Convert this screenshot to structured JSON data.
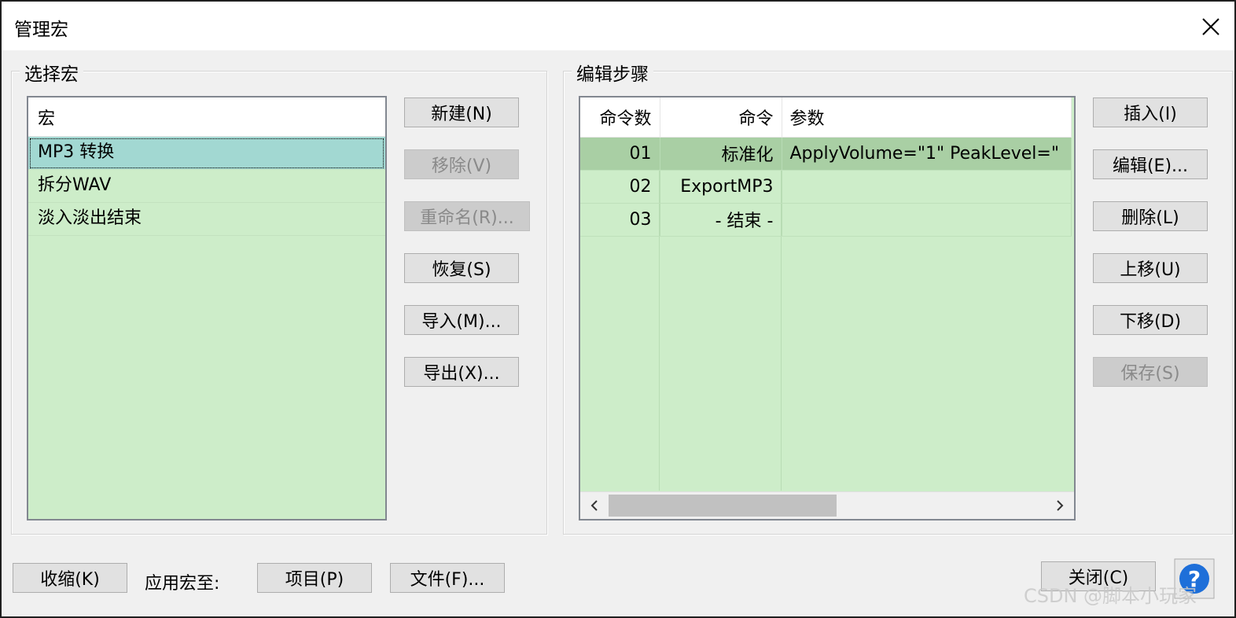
{
  "window": {
    "title": "管理宏"
  },
  "select_group": {
    "legend": "选择宏",
    "list_header": "宏",
    "items": [
      "MP3 转换",
      "拆分WAV",
      "淡入淡出结束"
    ],
    "selected_index": 0
  },
  "left_buttons": {
    "new": "新建(N)",
    "remove": "移除(V)",
    "rename": "重命名(R)...",
    "restore": "恢复(S)",
    "import": "导入(M)...",
    "export": "导出(X)..."
  },
  "edit_group": {
    "legend": "编辑步骤",
    "columns": [
      "命令数",
      "命令",
      "参数"
    ],
    "rows": [
      {
        "num": "01",
        "command": "标准化",
        "params": "ApplyVolume=\"1\" PeakLevel=\""
      },
      {
        "num": "02",
        "command": "ExportMP3",
        "params": ""
      },
      {
        "num": "03",
        "command": "- 结束 -",
        "params": ""
      }
    ]
  },
  "right_buttons": {
    "insert": "插入(I)",
    "edit": "编辑(E)...",
    "delete": "删除(L)",
    "move_up": "上移(U)",
    "move_down": "下移(D)",
    "save": "保存(S)"
  },
  "bottom": {
    "collapse": "收缩(K)",
    "apply_label": "应用宏至:",
    "project": "项目(P)",
    "files": "文件(F)...",
    "close": "关闭(C)",
    "help_icon": "question-mark"
  },
  "watermark": "CSDN @脚本小玩家",
  "colors": {
    "list_bg": "#cdedc9",
    "list_selected": "#a2d8d2",
    "grid_selected": "#a9cfa4",
    "help_blue": "#1e6fd9"
  }
}
